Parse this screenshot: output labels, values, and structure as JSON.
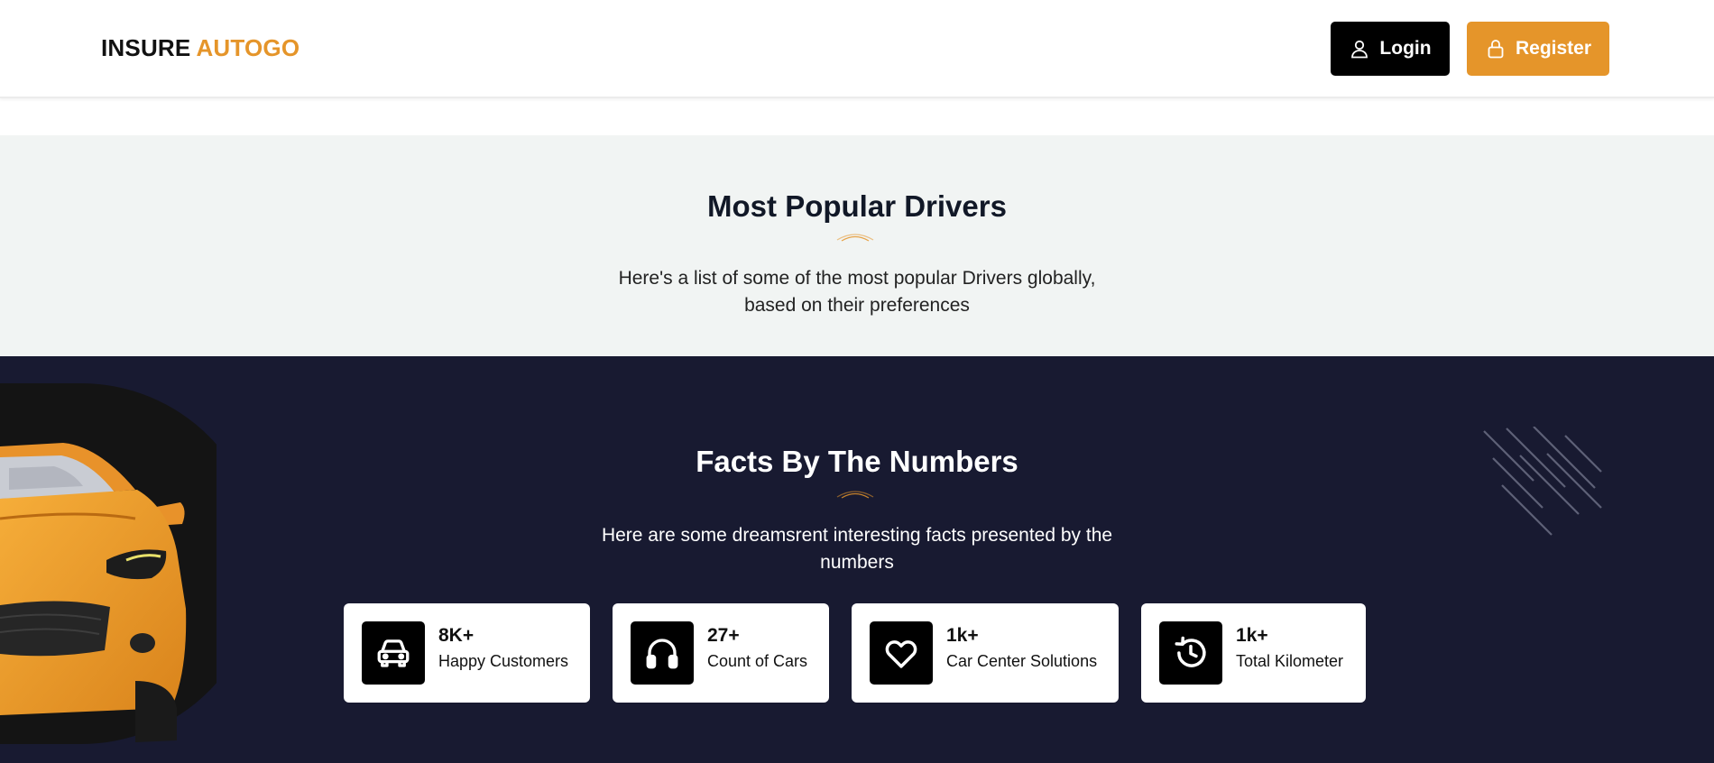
{
  "header": {
    "logo_part1": "INSURE",
    "logo_part2": "AUTOGO",
    "login_label": "Login",
    "register_label": "Register"
  },
  "popular": {
    "title": "Most Popular Drivers",
    "subtitle_line1": "Here's a list of some of the most popular Drivers globally,",
    "subtitle_line2": "based on their preferences"
  },
  "facts": {
    "title": "Facts By The Numbers",
    "subtitle_line1": "Here are some dreamsrent interesting facts presented by the",
    "subtitle_line2": "numbers",
    "stats": [
      {
        "value": "8K+",
        "label": "Happy Customers",
        "icon": "car-icon"
      },
      {
        "value": "27+",
        "label": "Count of Cars",
        "icon": "headphones-icon"
      },
      {
        "value": "1k+",
        "label": "Car Center Solutions",
        "icon": "heart-icon"
      },
      {
        "value": "1k+",
        "label": "Total Kilometer",
        "icon": "history-icon"
      }
    ]
  },
  "colors": {
    "accent": "#e5952a",
    "dark_section": "#181a31",
    "light_section": "#f1f4f3",
    "login_button": "#000000"
  }
}
